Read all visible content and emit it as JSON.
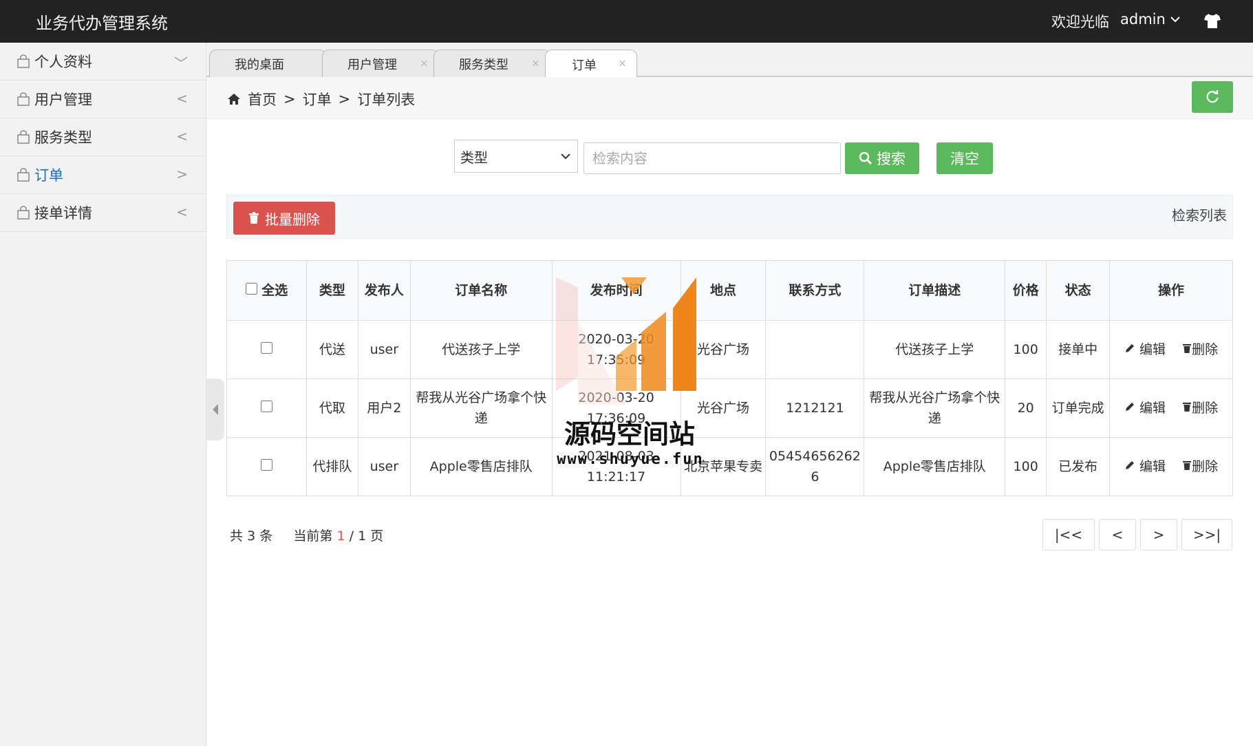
{
  "header": {
    "app_title": "业务代办管理系统",
    "welcome": "欢迎光临",
    "username": "admin"
  },
  "sidebar": {
    "items": [
      {
        "label": "个人资料",
        "arrow": "﹀"
      },
      {
        "label": "用户管理",
        "arrow": "<"
      },
      {
        "label": "服务类型",
        "arrow": "<"
      },
      {
        "label": "订单",
        "arrow": ">"
      },
      {
        "label": "接单详情",
        "arrow": "<"
      }
    ]
  },
  "tabs": [
    {
      "label": "我的桌面"
    },
    {
      "label": "用户管理",
      "close": "×"
    },
    {
      "label": "服务类型",
      "close": "×"
    },
    {
      "label": "订单",
      "close": "×"
    }
  ],
  "breadcrumb": {
    "home": "首页",
    "sep": ">",
    "level1": "订单",
    "level2": "订单列表"
  },
  "search": {
    "type_selected": "类型",
    "placeholder": "检索内容",
    "search_label": "搜索",
    "clear_label": "清空"
  },
  "toolbar": {
    "batch_delete_label": "批量删除",
    "list_title": "检索列表"
  },
  "table": {
    "headers": {
      "select_all": "全选",
      "type": "类型",
      "publisher": "发布人",
      "order_name": "订单名称",
      "publish_time": "发布时间",
      "location": "地点",
      "contact": "联系方式",
      "description": "订单描述",
      "price": "价格",
      "status": "状态",
      "actions": "操作"
    },
    "rows": [
      {
        "type": "代送",
        "publisher": "user",
        "name": "代送孩子上学",
        "time": "2020-03-20 17:35:09",
        "location": "光谷广场",
        "contact": "",
        "description": "代送孩子上学",
        "price": "100",
        "status": "接单中",
        "edit": "编辑",
        "del": "删除"
      },
      {
        "type": "代取",
        "publisher": "用户2",
        "name": "帮我从光谷广场拿个快递",
        "time": "2020-03-20 17:36:09",
        "location": "光谷广场",
        "contact": "1212121",
        "description": "帮我从光谷广场拿个快递",
        "price": "20",
        "status": "订单完成",
        "edit": "编辑",
        "del": "删除"
      },
      {
        "type": "代排队",
        "publisher": "user",
        "name": "Apple零售店排队",
        "time": "2021-08-03 11:21:17",
        "location": "北京苹果专卖",
        "contact": "054546562626",
        "description": "Apple零售店排队",
        "price": "100",
        "status": "已发布",
        "edit": "编辑",
        "del": "删除"
      }
    ]
  },
  "pagination": {
    "total_prefix": "共",
    "total": "3",
    "total_suffix": "条",
    "current_prefix": "当前第",
    "current": "1",
    "pages": "/ 1 页",
    "first": "|<<",
    "prev": "<",
    "next": ">",
    "last": ">>|"
  },
  "watermark": {
    "text": "源码空间站",
    "url": "www.shuyue.fun"
  },
  "colors": {
    "header_bg": "#222222",
    "accent_green": "#5cb85c",
    "danger_red": "#d9534f",
    "active_blue": "#1e6fb8"
  }
}
